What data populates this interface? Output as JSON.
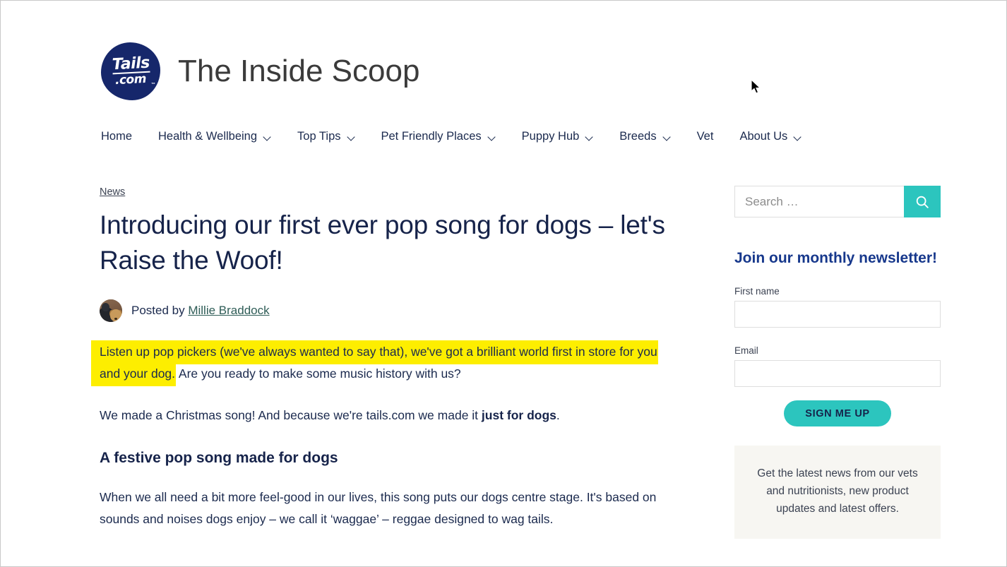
{
  "header": {
    "logo_line1": "Tails",
    "logo_line2": ".com",
    "logo_tm": "™",
    "site_title": "The Inside Scoop"
  },
  "nav": {
    "items": [
      {
        "label": "Home",
        "has_caret": false
      },
      {
        "label": "Health & Wellbeing",
        "has_caret": true
      },
      {
        "label": "Top Tips",
        "has_caret": true
      },
      {
        "label": "Pet Friendly Places",
        "has_caret": true
      },
      {
        "label": "Puppy Hub",
        "has_caret": true
      },
      {
        "label": "Breeds",
        "has_caret": true
      },
      {
        "label": "Vet",
        "has_caret": false
      },
      {
        "label": "About Us",
        "has_caret": true
      }
    ]
  },
  "article": {
    "category": "News",
    "title": "Introducing our first ever pop song for dogs – let's Raise the Woof!",
    "byline_prefix": "Posted by",
    "author": "Millie Braddock",
    "lede_highlighted": "Listen up pop pickers (we've always wanted to say that), we've got a brilliant world first in store for you and your dog.",
    "lede_rest": " Are you ready to make some music history with us?",
    "para2_before": "We made a Christmas song! And because we're tails.com we made it ",
    "para2_bold": "just for dogs",
    "para2_after": ".",
    "subheading": "A festive pop song made for dogs",
    "para3": "When we all need a bit more feel-good in our lives, this song puts our dogs centre stage. It's based on sounds and noises dogs enjoy – we call it ‘waggae’ – reggae designed to wag tails."
  },
  "sidebar": {
    "search_placeholder": "Search …",
    "search_value": "",
    "search_icon": "magnifier-icon",
    "newsletter_title": "Join our monthly newsletter!",
    "first_name_label": "First name",
    "first_name_value": "",
    "email_label": "Email",
    "email_value": "",
    "signup_label": "SIGN ME UP",
    "info_text": "Get the latest news from our vets and nutritionists, new product updates and latest offers."
  },
  "colors": {
    "navy": "#16234a",
    "brand_blue": "#17388c",
    "teal": "#2cc5be",
    "highlight_yellow": "#fdee00",
    "link_teal": "#2f5d57",
    "info_bg": "#f7f6f2"
  }
}
